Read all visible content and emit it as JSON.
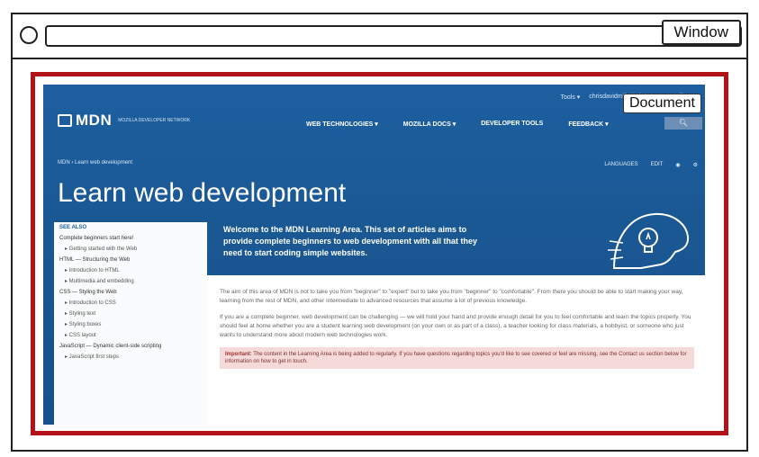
{
  "window": {
    "label": "Window"
  },
  "document": {
    "label": "Document"
  },
  "mdn": {
    "topbar": [
      "Tools ▾",
      "chrisdavidmills | Sign out",
      "mozilla"
    ],
    "logo_text": "MDN",
    "logo_sub": "MOZILLA DEVELOPER NETWORK",
    "nav": [
      "WEB TECHNOLOGIES ▾",
      "MOZILLA DOCS ▾",
      "DEVELOPER TOOLS",
      "FEEDBACK ▾"
    ],
    "search_icon": "search-icon",
    "breadcrumb": "MDN ›   Learn web development",
    "tools": [
      "LANGUAGES",
      "EDIT",
      "◉",
      "⚙"
    ],
    "title": "Learn web development",
    "sidebar": [
      {
        "label": "SEE ALSO",
        "kind": "head"
      },
      {
        "label": "Complete beginners start here!",
        "kind": "item"
      },
      {
        "label": "▸ Getting started with the Web",
        "kind": "sub"
      },
      {
        "label": "HTML — Structuring the Web",
        "kind": "item"
      },
      {
        "label": "▸ Introduction to HTML",
        "kind": "sub"
      },
      {
        "label": "▸ Multimedia and embedding",
        "kind": "sub"
      },
      {
        "label": "CSS — Styling the Web",
        "kind": "item"
      },
      {
        "label": "▸ Introduction to CSS",
        "kind": "sub"
      },
      {
        "label": "▸ Styling text",
        "kind": "sub"
      },
      {
        "label": "▸ Styling boxes",
        "kind": "sub"
      },
      {
        "label": "▸ CSS layout",
        "kind": "sub"
      },
      {
        "label": "JavaScript — Dynamic client-side scripting",
        "kind": "item"
      },
      {
        "label": "▸ JavaScript first steps",
        "kind": "sub"
      }
    ],
    "intro": "Welcome to the MDN Learning Area. This set of articles aims to provide complete beginners to web development with all that they need to start coding simple websites.",
    "body_paragraphs": [
      "The aim of this area of MDN is not to take you from \"beginner\" to \"expert\" but to take you from \"beginner\" to \"comfortable\". From there you should be able to start making your way, learning from the rest of MDN, and other intermediate to advanced resources that assume a lot of previous knowledge.",
      "If you are a complete beginner, web development can be challenging — we will hold your hand and provide enough detail for you to feel comfortable and learn the topics properly. You should feel at home whether you are a student learning web development (on your own or as part of a class), a teacher looking for class materials, a hobbyist, or someone who just wants to understand more about modern web technologies work."
    ],
    "important_label": "Important:",
    "important_text": "The content in the Learning Area is being added to regularly. If you have questions regarding topics you'd like to see covered or feel are missing, see the Contact us section below for information on how to get in touch."
  }
}
